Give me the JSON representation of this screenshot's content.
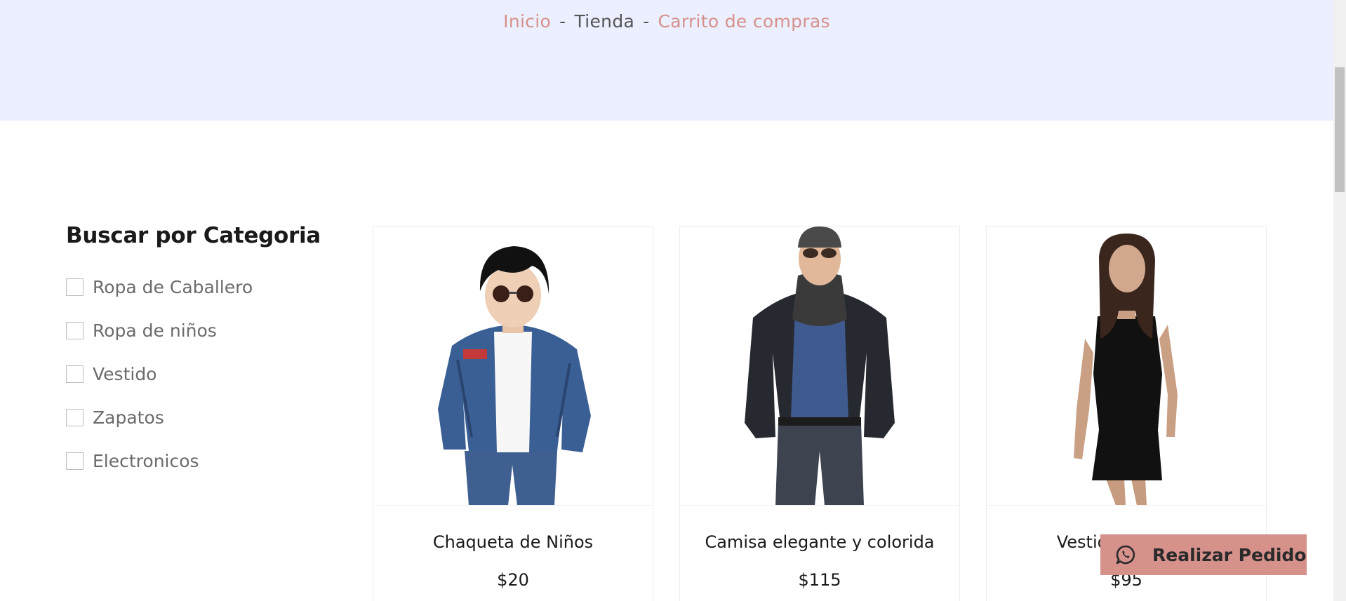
{
  "breadcrumb": {
    "home": "Inicio",
    "separator": "-",
    "current": "Tienda",
    "cart": "Carrito de compras"
  },
  "sidebar": {
    "title": "Buscar por Categoria",
    "categories": [
      {
        "label": "Ropa de Caballero",
        "checked": false
      },
      {
        "label": "Ropa de niños",
        "checked": false
      },
      {
        "label": "Vestido",
        "checked": false
      },
      {
        "label": "Zapatos",
        "checked": false
      },
      {
        "label": "Electronicos",
        "checked": false
      }
    ]
  },
  "products": [
    {
      "name": "Chaqueta de Niños",
      "price": "$20",
      "image": "boy-denim-jacket-photo"
    },
    {
      "name": "Camisa elegante y colorida",
      "price": "$115",
      "image": "man-leather-jacket-photo"
    },
    {
      "name": "Vestido ajustado",
      "price": "$95",
      "image": "woman-black-dress-photo"
    }
  ],
  "order_button": {
    "label": "Realizar Pedido",
    "icon": "whatsapp-icon"
  },
  "colors": {
    "accent": "#d6918b",
    "hero_bg": "#ecefff"
  }
}
